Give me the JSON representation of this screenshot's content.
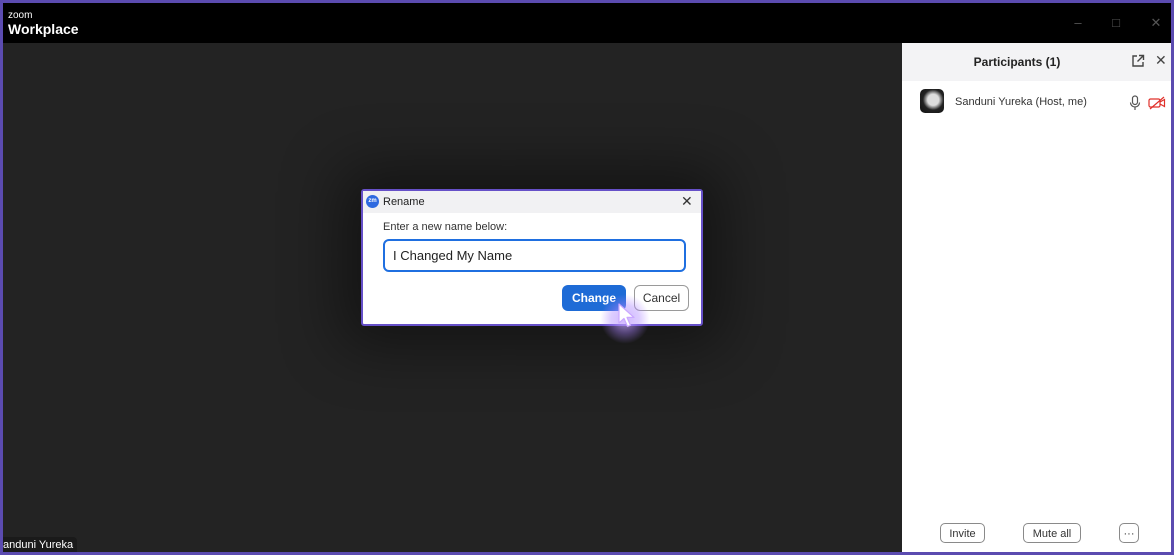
{
  "app": {
    "brand_small": "zoom",
    "brand_name": "Workplace"
  },
  "video": {
    "name_tag": "anduni Yureka"
  },
  "panel": {
    "title": "Participants (1)",
    "participant": {
      "name": "Sanduni Yureka (Host, me)"
    },
    "invite_label": "Invite",
    "mute_all_label": "Mute all",
    "more_label": "···"
  },
  "dialog": {
    "icon_text": "zm",
    "title": "Rename",
    "prompt": "Enter a new name below:",
    "input_value": "I Changed My Name",
    "change_label": "Change",
    "cancel_label": "Cancel"
  },
  "colors": {
    "accent": "#1e6bd6",
    "frame": "#6650c8",
    "muted_camera": "#e0302a"
  },
  "icons": [
    "popout-icon",
    "close-icon",
    "mic-icon",
    "camera-off-icon",
    "pointer-cursor-icon"
  ]
}
